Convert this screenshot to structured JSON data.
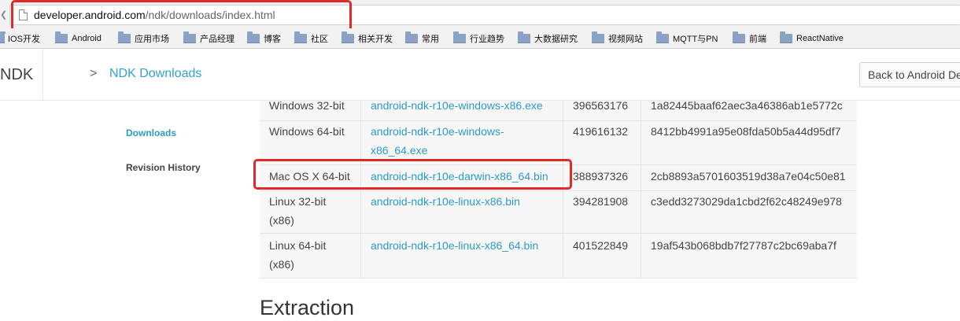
{
  "browser": {
    "url_host": "developer.android.com",
    "url_path": "/ndk/downloads/index.html",
    "bookmarks": [
      "IOS开发",
      "Android",
      "应用市场",
      "产品经理",
      "博客",
      "社区",
      "相关开发",
      "常用",
      "行业趋势",
      "大数据研究",
      "视频网站",
      "MQTT与PN",
      "前端",
      "ReactNative"
    ]
  },
  "header": {
    "site_name": "NDK",
    "breadcrumb_sep": ">",
    "breadcrumb": "NDK Downloads",
    "back_button": "Back to Android Developers"
  },
  "nav": {
    "downloads": "Downloads",
    "revision_history": "Revision History"
  },
  "table": {
    "rows": [
      {
        "platform": "Windows 32-bit",
        "package_lines": [
          "android-ndk-r10e-windows-x86.exe"
        ],
        "size": "396563176",
        "checksum": "1a82445baaf62aec3a46386ab1e5772c"
      },
      {
        "platform": "Windows 64-bit",
        "package_lines": [
          "android-ndk-r10e-windows-",
          "x86_64.exe"
        ],
        "size": "419616132",
        "checksum": "8412bb4991a95e08fda50b5a44d95df7"
      },
      {
        "platform": "Mac OS X 64-bit",
        "package_lines": [
          "android-ndk-r10e-darwin-x86_64.bin"
        ],
        "size": "388937326",
        "checksum": "2cb8893a5701603519d38a7e04c50e81"
      },
      {
        "platform_lines": [
          "Linux 32-bit",
          "(x86)"
        ],
        "package_lines": [
          "android-ndk-r10e-linux-x86.bin"
        ],
        "size": "394281908",
        "checksum": "c3edd3273029da1cbd2f62c48249e978"
      },
      {
        "platform_lines": [
          "Linux 64-bit",
          "(x86)"
        ],
        "package_lines": [
          "android-ndk-r10e-linux-x86_64.bin"
        ],
        "size": "401522849",
        "checksum": "19af543b068bdb7f27787c2bc69aba7f"
      }
    ]
  },
  "section": {
    "extraction": "Extraction"
  },
  "colors": {
    "link": "#2a9bc9",
    "annotation": "#e02a2a"
  }
}
